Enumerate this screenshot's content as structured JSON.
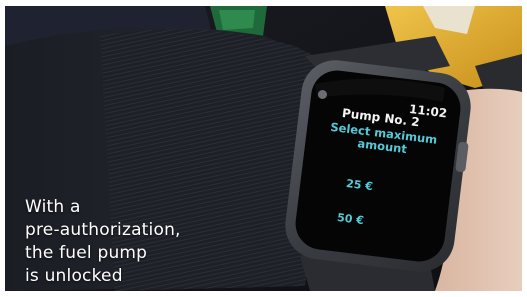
{
  "caption": {
    "line1": "With a",
    "line2": "pre-authorization,",
    "line3": "the fuel pump",
    "line4": "is unlocked"
  },
  "watch": {
    "time": "11:02",
    "title": "Pump No. 2",
    "prompt_line1": "Select maximum",
    "prompt_line2": "amount",
    "options": [
      "25 €",
      "50 €"
    ],
    "back_icon": "back-circle-icon",
    "accent_color": "#55c9d6"
  }
}
